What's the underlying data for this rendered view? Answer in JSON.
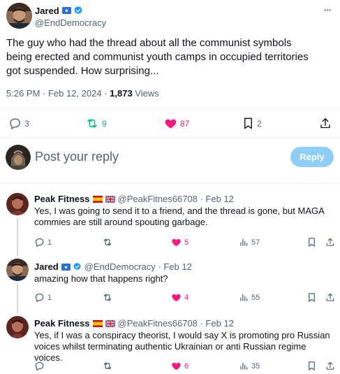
{
  "main_tweet": {
    "author_name": "Jared",
    "handle": "@EndDemocracy",
    "text": "The guy who had the thread about all the communist symbols being erected and communist youth camps in occupied territories got suspended. How surprising...",
    "time": "5:26 PM · Feb 12, 2024 · ",
    "views_count": "1,873",
    "views_label": " Views",
    "replies": "3",
    "reposts": "9",
    "likes": "87",
    "bookmarks": "2",
    "more_label": "···"
  },
  "composer": {
    "placeholder": "Post your reply",
    "reply_label": "Reply"
  },
  "replies": [
    {
      "author_name": "Peak Fitness",
      "handle": "@PeakFitnes66708 · Feb 12",
      "text_line1": "Yes, I was going to send it to a friend, and the thread is gone, but MAGA",
      "text_line2": "commies are still around spouting garbage.",
      "replies": "1",
      "reposts": "",
      "likes": "5",
      "views": "57"
    },
    {
      "author_name": "Jared",
      "handle": "@EndDemocracy · Feb 12",
      "text_line1": "amazing how that happens right?",
      "text_line2": "",
      "replies": "1",
      "reposts": "",
      "likes": "4",
      "views": "55"
    },
    {
      "author_name": "Peak Fitness",
      "handle": "@PeakFitnes66708 · Feb 12",
      "text_line1": "Yes, if I was a conspiracy theorist, I would say X is promoting pro Russian",
      "text_line2": "voices whilst terminating authentic Ukrainian or anti Russian regime voices.",
      "replies": "",
      "reposts": "",
      "likes": "6",
      "views": "35"
    }
  ],
  "colors": {
    "accent": "#1d9bf0",
    "reply_button_disabled": "#8ecdf8",
    "repost_green": "#00ba7c",
    "like_pink": "#f91880",
    "muted": "#536471"
  }
}
